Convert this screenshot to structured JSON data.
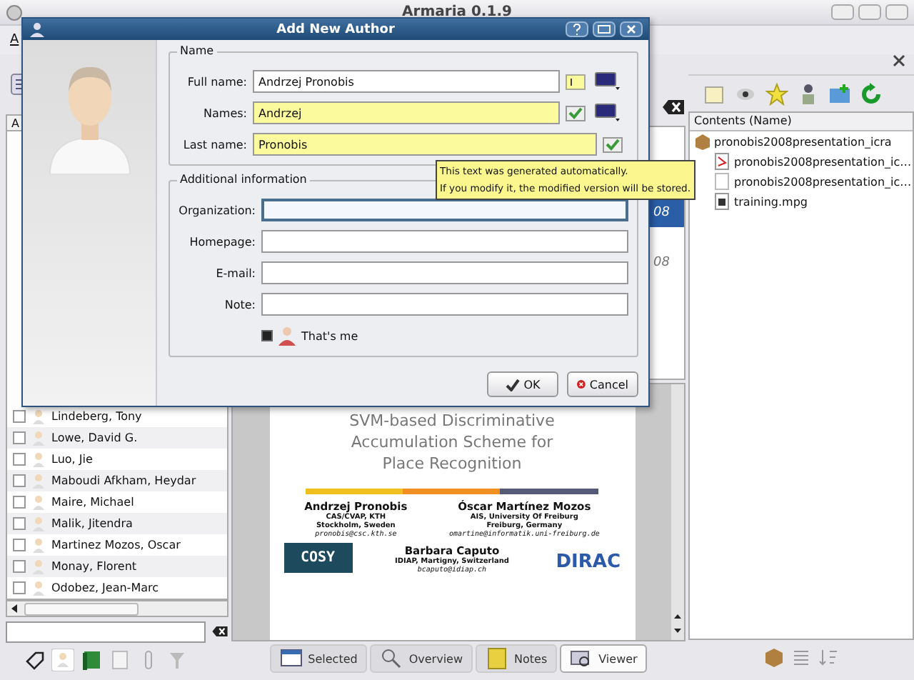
{
  "window": {
    "title": "Armaria 0.1.9"
  },
  "menu": [
    "A"
  ],
  "authors_panel": {
    "column_header": "A",
    "rows": [
      {
        "name": "Lindeberg, Tony",
        "checked": false
      },
      {
        "name": "Lowe, David G.",
        "checked": false
      },
      {
        "name": "Luo, Jie",
        "checked": false
      },
      {
        "name": "Maboudi Afkham, Heydar",
        "checked": false
      },
      {
        "name": "Maire, Michael",
        "checked": false
      },
      {
        "name": "Malik, Jitendra",
        "checked": false
      },
      {
        "name": "Martinez Mozos, Oscar",
        "checked": false
      },
      {
        "name": "Monay, Florent",
        "checked": false
      },
      {
        "name": "Odobez, Jean-Marc",
        "checked": false
      }
    ]
  },
  "documents_list": {
    "rows": [
      {
        "text": "08",
        "selected": true
      },
      {
        "text": "08",
        "selected": false
      }
    ]
  },
  "slide": {
    "title": "SVM-based Discriminative Accumulation Scheme for Place Recognition",
    "authors": [
      {
        "name": "Andrzej Pronobis",
        "lines": [
          "CAS/CVAP, KTH",
          "Stockholm, Sweden"
        ],
        "email": "pronobis@csc.kth.se"
      },
      {
        "name": "Óscar Martínez Mozos",
        "lines": [
          "AIS, University Of Freiburg",
          "Freiburg, Germany"
        ],
        "email": "omartine@informatik.uni-freiburg.de"
      },
      {
        "name": "Barbara Caputo",
        "lines": [
          "IDIAP, Martigny, Switzerland"
        ],
        "email": "bcaputo@idiap.ch"
      }
    ],
    "logos": [
      "COSY",
      "DIRAC"
    ]
  },
  "view_tabs": [
    {
      "label": "Selected",
      "selected": false
    },
    {
      "label": "Overview",
      "selected": false
    },
    {
      "label": "Notes",
      "selected": false
    },
    {
      "label": "Viewer",
      "selected": true
    }
  ],
  "contents": {
    "header": "Contents (Name)",
    "tree": [
      {
        "label": "pronobis2008presentation_icra",
        "kind": "package",
        "children": [
          {
            "label": "pronobis2008presentation_ic…",
            "kind": "pdf"
          },
          {
            "label": "pronobis2008presentation_ic…",
            "kind": "blank"
          },
          {
            "label": "training.mpg",
            "kind": "video"
          }
        ]
      }
    ]
  },
  "dialog": {
    "title": "Add New Author",
    "name_group": {
      "title": "Name",
      "fields": [
        {
          "label": "Full name:",
          "value": "Andrzej Pronobis",
          "auto": false,
          "color_menu": true
        },
        {
          "label": "Names:",
          "value": "Andrzej",
          "auto": true,
          "color_menu": true
        },
        {
          "label": "Last name:",
          "value": "Pronobis",
          "auto": true,
          "color_menu": false
        }
      ]
    },
    "additional_group": {
      "title": "Additional information",
      "fields": [
        {
          "label": "Organization:",
          "focused": true
        },
        {
          "label": "Homepage:",
          "focused": false
        },
        {
          "label": "E-mail:",
          "focused": false
        },
        {
          "label": "Note:",
          "focused": false
        }
      ]
    },
    "thats_me": {
      "label": "That's me",
      "checked": true
    },
    "buttons": [
      {
        "label": "OK",
        "kind": "ok"
      },
      {
        "label": "Cancel",
        "kind": "cancel"
      }
    ]
  },
  "tooltip": {
    "lines": [
      "This text was generated automatically.",
      "If you modify it, the modified version will be stored."
    ]
  }
}
